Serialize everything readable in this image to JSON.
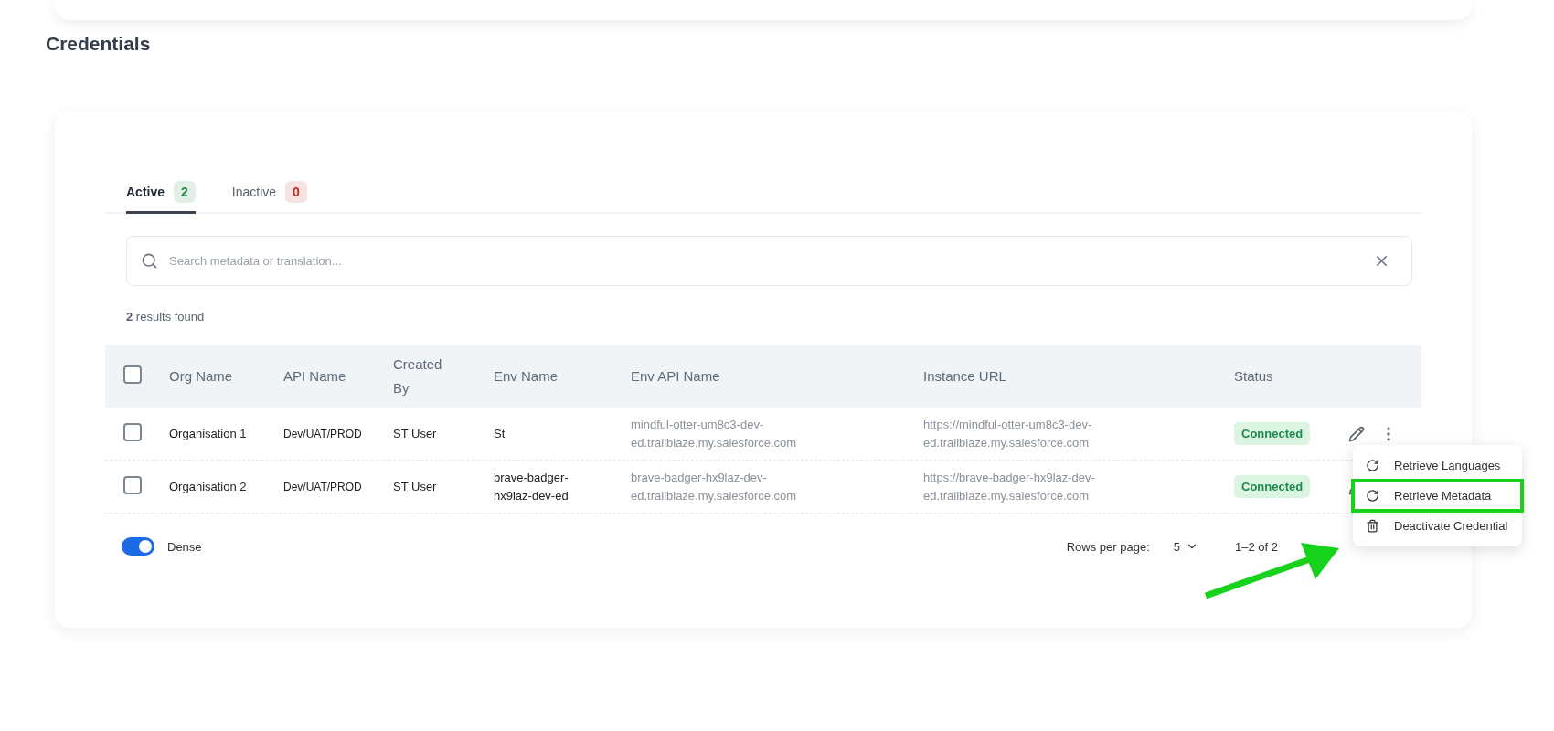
{
  "heading": "Credentials",
  "tabs": [
    {
      "label": "Active",
      "count": "2",
      "color": "#1f8a4c",
      "selected": true
    },
    {
      "label": "Inactive",
      "count": "0",
      "color": "#c62a1f",
      "selected": false
    }
  ],
  "search": {
    "placeholder": "Search metadata or translation..."
  },
  "results": "**2** results found",
  "table": {
    "select_all_checked": false,
    "columns": [
      "Org Name",
      "API Name",
      "Created By",
      "Env Name",
      "Env API Name",
      "Instance URL",
      "Status"
    ],
    "rows": [
      {
        "checked": false,
        "cells": [
          "Organisation 1",
          "Dev/UAT/PROD",
          "ST User",
          "St",
          "mindful-otter-um8c3-dev-ed.trailblaze.my.salesforce.com",
          "https://mindful-otter-um8c3-dev-ed.trailblaze.my.salesforce.com"
        ],
        "status": "Connected",
        "show_menu_button": true
      },
      {
        "checked": false,
        "cells": [
          "Organisation 2",
          "Dev/UAT/PROD",
          "ST User",
          "brave-badger-hx9laz-dev-ed",
          "brave-badger-hx9laz-dev-ed.trailblaze.my.salesforce.com",
          "https://brave-badger-hx9laz-dev-ed.trailblaze.my.salesforce.com"
        ],
        "status": "Connected",
        "show_menu_button": false
      }
    ]
  },
  "dense": {
    "label": "Dense",
    "on": true
  },
  "pagination": {
    "rows_per_page_label": "Rows per page:",
    "rows_per_page": "5",
    "range": "1–2 of 2"
  },
  "menu": [
    {
      "kind": "refresh",
      "label": "Retrieve Languages",
      "highlighted": false
    },
    {
      "kind": "refresh",
      "label": "Retrieve Metadata",
      "highlighted": true
    },
    {
      "kind": "delete",
      "label": "Deactivate Credential",
      "highlighted": false
    }
  ]
}
